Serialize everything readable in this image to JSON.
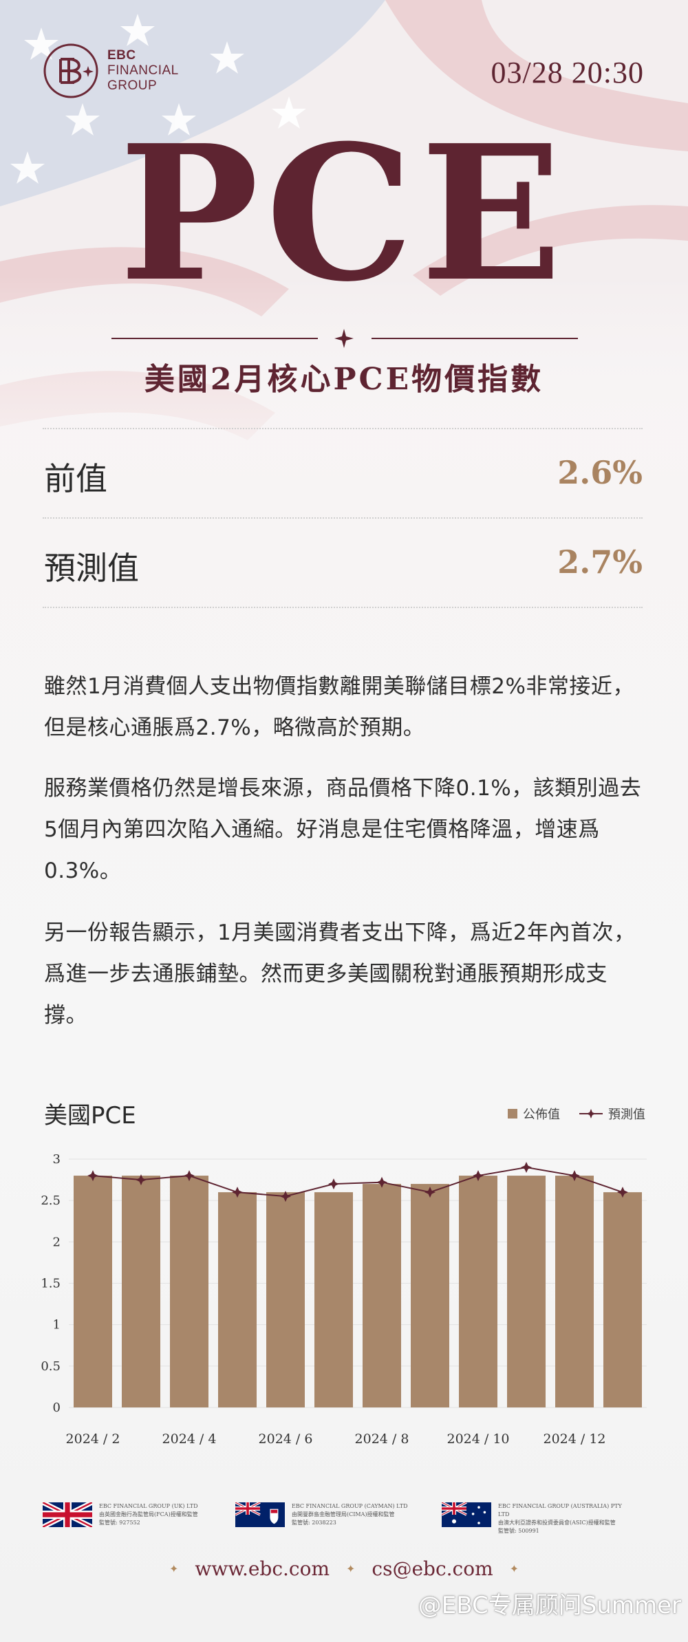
{
  "header": {
    "company_line1": "EBC",
    "company_line2": "FINANCIAL",
    "company_line3": "GROUP",
    "datetime": "03/28 20:30"
  },
  "title": {
    "main": "PCE",
    "subtitle": "美國2月核心PCE物價指數"
  },
  "stats": [
    {
      "label": "前值",
      "value": "2.6%"
    },
    {
      "label": "預測值",
      "value": "2.7%"
    }
  ],
  "paragraphs": [
    "雖然1月消費個人支出物價指數離開美聯儲目標2%非常接近，但是核心通脹爲2.7%，略微高於預期。",
    "服務業價格仍然是增長來源，商品價格下降0.1%，該類別過去5個月內第四次陷入通縮。好消息是住宅價格降溫，增速爲0.3%。",
    "另一份報告顯示，1月美國消費者支出下降，爲近2年內首次，爲進一步去通脹鋪墊。然而更多美國關稅對通脹預期形成支撐。"
  ],
  "chart_data": {
    "type": "bar",
    "title": "美國PCE",
    "categories": [
      "2024/2",
      "2024/3",
      "2024/4",
      "2024/5",
      "2024/6",
      "2024/7",
      "2024/8",
      "2024/9",
      "2024/10",
      "2024/11",
      "2024/12",
      "2025/1"
    ],
    "tick_labels": [
      "2024 / 2",
      "2024 / 4",
      "2024 / 6",
      "2024 / 8",
      "2024 / 10",
      "2024 / 12"
    ],
    "series": [
      {
        "name": "公佈值",
        "type": "bar",
        "values": [
          2.8,
          2.8,
          2.8,
          2.6,
          2.6,
          2.6,
          2.7,
          2.7,
          2.8,
          2.8,
          2.8,
          2.6
        ],
        "color": "#a8876a"
      },
      {
        "name": "預測值",
        "type": "line",
        "values": [
          2.8,
          2.75,
          2.8,
          2.6,
          2.55,
          2.7,
          2.72,
          2.6,
          2.8,
          2.9,
          2.8,
          2.6
        ],
        "color": "#5e2431"
      }
    ],
    "ylim": [
      0,
      3
    ],
    "yticks": [
      "0",
      "0.5",
      "1",
      "1.5",
      "2",
      "2.5",
      "3"
    ],
    "grid": true,
    "legend": "top-right"
  },
  "regulators": [
    {
      "name": "EBC FINANCIAL GROUP (UK) LTD",
      "desc": "由英國金融行為監管局(FCA)授權和監管",
      "reg_no": "監管號: 927552",
      "flag": "uk-flag-icon"
    },
    {
      "name": "EBC FINANCIAL GROUP (CAYMAN) LTD",
      "desc": "由開曼群島金融管理局(CIMA)授權和監管",
      "reg_no": "監管號: 2038223",
      "flag": "cayman-flag-icon"
    },
    {
      "name": "EBC FINANCIAL GROUP (AUSTRALIA) PTY LTD",
      "desc": "由澳大利亞證券和投資委員會(ASIC)授權和監管",
      "reg_no": "監管號: 500991",
      "flag": "australia-flag-icon"
    }
  ],
  "footer": {
    "website": "www.ebc.com",
    "email": "cs@ebc.com"
  },
  "watermark": "@EBC专属顾问Summer",
  "colors": {
    "brand": "#5e2431",
    "accent": "#a98360",
    "bar": "#a8876a"
  }
}
